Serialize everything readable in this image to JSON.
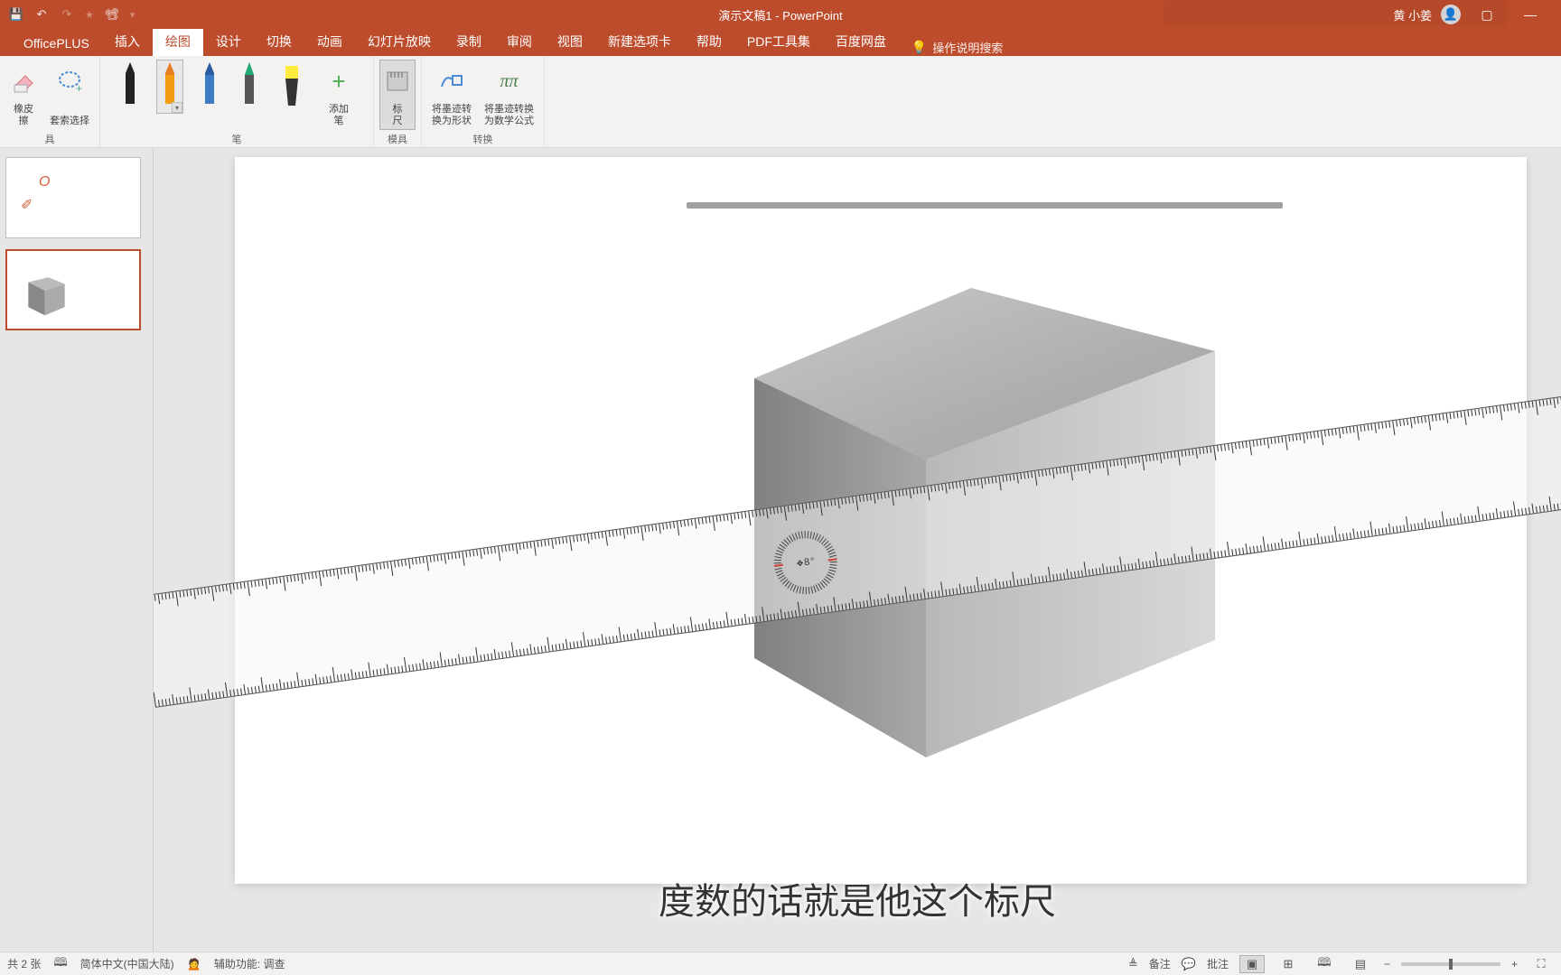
{
  "title": "演示文稿1 - PowerPoint",
  "user": {
    "name": "黄 小姜"
  },
  "qat": {
    "save": "💾",
    "undo": "↶",
    "redo": "↷",
    "start": "▶"
  },
  "tabs": [
    "OfficePLUS",
    "插入",
    "绘图",
    "设计",
    "切换",
    "动画",
    "幻灯片放映",
    "录制",
    "审阅",
    "视图",
    "新建选项卡",
    "帮助",
    "PDF工具集",
    "百度网盘"
  ],
  "active_tab": 2,
  "search_hint": "操作说明搜索",
  "ribbon": {
    "tools": {
      "eraser": "橡皮\n擦",
      "lasso": "套索选择",
      "label": "具"
    },
    "pens": {
      "add": "添加\n笔",
      "label": "笔"
    },
    "stencil": {
      "ruler": "标\n尺",
      "label": "模具"
    },
    "convert": {
      "shape": "将墨迹转\n换为形状",
      "math": "将墨迹转换\n为数学公式",
      "label": "转换"
    }
  },
  "ruler_angle": "8",
  "subtitle": "度数的话就是他这个标尺",
  "status": {
    "slides": "共 2 张",
    "lang": "简体中文(中国大陆)",
    "access": "辅助功能: 调查",
    "notes": "备注",
    "comments": "批注"
  }
}
